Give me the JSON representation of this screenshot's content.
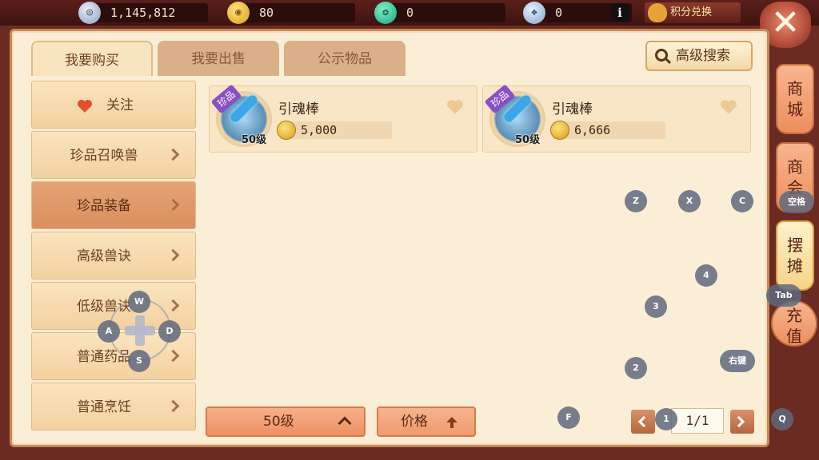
{
  "topbar": {
    "silver": "1,145,812",
    "gold": "80",
    "jade": "0",
    "tickets": "0",
    "info_icon": "i",
    "exchange_label": "积分兑换",
    "close_icon": "✕"
  },
  "tabs": [
    {
      "label": "我要购买",
      "active": true
    },
    {
      "label": "我要出售",
      "active": false
    },
    {
      "label": "公示物品",
      "active": false
    }
  ],
  "advanced_search": "高级搜索",
  "sidebar": {
    "items": [
      {
        "label": "关注",
        "icon": "heart-icon"
      },
      {
        "label": "珍品召唤兽"
      },
      {
        "label": "珍品装备",
        "active": true
      },
      {
        "label": "高级兽诀"
      },
      {
        "label": "低级兽诀"
      },
      {
        "label": "普通药品"
      },
      {
        "label": "普通烹饪"
      }
    ]
  },
  "goods": [
    {
      "name": "引魂棒",
      "rarity": "珍品",
      "level": "50级",
      "price": "5,000"
    },
    {
      "name": "引魂棒",
      "rarity": "珍品",
      "level": "50级",
      "price": "6,666"
    }
  ],
  "filter": {
    "level_label": "50级",
    "price_label": "价格"
  },
  "pagination": {
    "page": "1/1"
  },
  "right_tabs": [
    {
      "label": "商城"
    },
    {
      "label": "商会"
    },
    {
      "label": "摆摊",
      "active": true
    },
    {
      "label": "充值"
    }
  ],
  "key_hints": {
    "w": "W",
    "a": "A",
    "s": "S",
    "d": "D",
    "z": "Z",
    "x": "X",
    "c": "C",
    "space": "空格",
    "tab": "Tab",
    "k4": "4",
    "k3": "3",
    "k2": "2",
    "k1": "1",
    "right_click": "右键",
    "f": "F",
    "q": "Q"
  },
  "colors": {
    "frame_bg": "#fbeed6",
    "accent_orange": "#ee8f63",
    "rarity_purple": "#8a4fc2"
  }
}
